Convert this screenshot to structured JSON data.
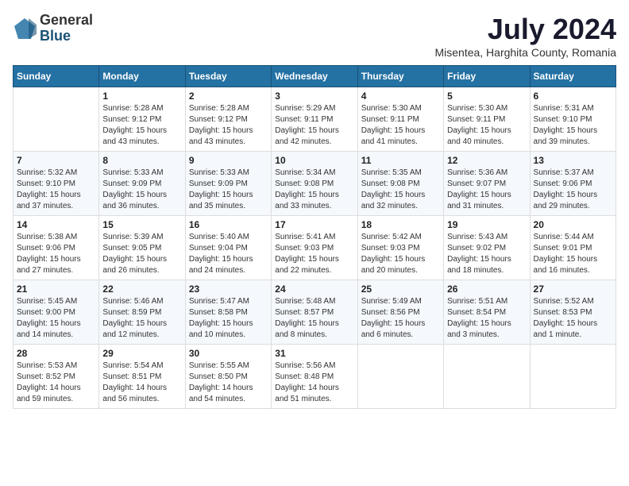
{
  "logo": {
    "general": "General",
    "blue": "Blue"
  },
  "title": "July 2024",
  "subtitle": "Misentea, Harghita County, Romania",
  "headers": [
    "Sunday",
    "Monday",
    "Tuesday",
    "Wednesday",
    "Thursday",
    "Friday",
    "Saturday"
  ],
  "weeks": [
    [
      {
        "day": "",
        "info": ""
      },
      {
        "day": "1",
        "info": "Sunrise: 5:28 AM\nSunset: 9:12 PM\nDaylight: 15 hours\nand 43 minutes."
      },
      {
        "day": "2",
        "info": "Sunrise: 5:28 AM\nSunset: 9:12 PM\nDaylight: 15 hours\nand 43 minutes."
      },
      {
        "day": "3",
        "info": "Sunrise: 5:29 AM\nSunset: 9:11 PM\nDaylight: 15 hours\nand 42 minutes."
      },
      {
        "day": "4",
        "info": "Sunrise: 5:30 AM\nSunset: 9:11 PM\nDaylight: 15 hours\nand 41 minutes."
      },
      {
        "day": "5",
        "info": "Sunrise: 5:30 AM\nSunset: 9:11 PM\nDaylight: 15 hours\nand 40 minutes."
      },
      {
        "day": "6",
        "info": "Sunrise: 5:31 AM\nSunset: 9:10 PM\nDaylight: 15 hours\nand 39 minutes."
      }
    ],
    [
      {
        "day": "7",
        "info": "Sunrise: 5:32 AM\nSunset: 9:10 PM\nDaylight: 15 hours\nand 37 minutes."
      },
      {
        "day": "8",
        "info": "Sunrise: 5:33 AM\nSunset: 9:09 PM\nDaylight: 15 hours\nand 36 minutes."
      },
      {
        "day": "9",
        "info": "Sunrise: 5:33 AM\nSunset: 9:09 PM\nDaylight: 15 hours\nand 35 minutes."
      },
      {
        "day": "10",
        "info": "Sunrise: 5:34 AM\nSunset: 9:08 PM\nDaylight: 15 hours\nand 33 minutes."
      },
      {
        "day": "11",
        "info": "Sunrise: 5:35 AM\nSunset: 9:08 PM\nDaylight: 15 hours\nand 32 minutes."
      },
      {
        "day": "12",
        "info": "Sunrise: 5:36 AM\nSunset: 9:07 PM\nDaylight: 15 hours\nand 31 minutes."
      },
      {
        "day": "13",
        "info": "Sunrise: 5:37 AM\nSunset: 9:06 PM\nDaylight: 15 hours\nand 29 minutes."
      }
    ],
    [
      {
        "day": "14",
        "info": "Sunrise: 5:38 AM\nSunset: 9:06 PM\nDaylight: 15 hours\nand 27 minutes."
      },
      {
        "day": "15",
        "info": "Sunrise: 5:39 AM\nSunset: 9:05 PM\nDaylight: 15 hours\nand 26 minutes."
      },
      {
        "day": "16",
        "info": "Sunrise: 5:40 AM\nSunset: 9:04 PM\nDaylight: 15 hours\nand 24 minutes."
      },
      {
        "day": "17",
        "info": "Sunrise: 5:41 AM\nSunset: 9:03 PM\nDaylight: 15 hours\nand 22 minutes."
      },
      {
        "day": "18",
        "info": "Sunrise: 5:42 AM\nSunset: 9:03 PM\nDaylight: 15 hours\nand 20 minutes."
      },
      {
        "day": "19",
        "info": "Sunrise: 5:43 AM\nSunset: 9:02 PM\nDaylight: 15 hours\nand 18 minutes."
      },
      {
        "day": "20",
        "info": "Sunrise: 5:44 AM\nSunset: 9:01 PM\nDaylight: 15 hours\nand 16 minutes."
      }
    ],
    [
      {
        "day": "21",
        "info": "Sunrise: 5:45 AM\nSunset: 9:00 PM\nDaylight: 15 hours\nand 14 minutes."
      },
      {
        "day": "22",
        "info": "Sunrise: 5:46 AM\nSunset: 8:59 PM\nDaylight: 15 hours\nand 12 minutes."
      },
      {
        "day": "23",
        "info": "Sunrise: 5:47 AM\nSunset: 8:58 PM\nDaylight: 15 hours\nand 10 minutes."
      },
      {
        "day": "24",
        "info": "Sunrise: 5:48 AM\nSunset: 8:57 PM\nDaylight: 15 hours\nand 8 minutes."
      },
      {
        "day": "25",
        "info": "Sunrise: 5:49 AM\nSunset: 8:56 PM\nDaylight: 15 hours\nand 6 minutes."
      },
      {
        "day": "26",
        "info": "Sunrise: 5:51 AM\nSunset: 8:54 PM\nDaylight: 15 hours\nand 3 minutes."
      },
      {
        "day": "27",
        "info": "Sunrise: 5:52 AM\nSunset: 8:53 PM\nDaylight: 15 hours\nand 1 minute."
      }
    ],
    [
      {
        "day": "28",
        "info": "Sunrise: 5:53 AM\nSunset: 8:52 PM\nDaylight: 14 hours\nand 59 minutes."
      },
      {
        "day": "29",
        "info": "Sunrise: 5:54 AM\nSunset: 8:51 PM\nDaylight: 14 hours\nand 56 minutes."
      },
      {
        "day": "30",
        "info": "Sunrise: 5:55 AM\nSunset: 8:50 PM\nDaylight: 14 hours\nand 54 minutes."
      },
      {
        "day": "31",
        "info": "Sunrise: 5:56 AM\nSunset: 8:48 PM\nDaylight: 14 hours\nand 51 minutes."
      },
      {
        "day": "",
        "info": ""
      },
      {
        "day": "",
        "info": ""
      },
      {
        "day": "",
        "info": ""
      }
    ]
  ]
}
